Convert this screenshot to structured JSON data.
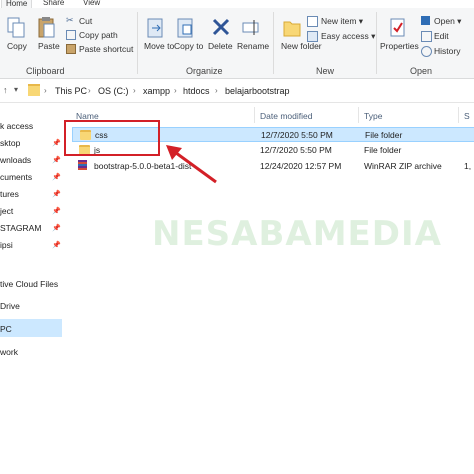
{
  "tabs": [
    "Home",
    "Share",
    "View"
  ],
  "ribbon": {
    "clipboard": {
      "copy": "Copy",
      "paste": "Paste",
      "cut": "Cut",
      "copy_path": "Copy path",
      "paste_shortcut": "Paste shortcut",
      "label": "Clipboard"
    },
    "organize": {
      "move_to": "Move to",
      "copy_to": "Copy to",
      "delete": "Delete",
      "rename": "Rename",
      "label": "Organize"
    },
    "new": {
      "new_folder": "New folder",
      "new_item": "New item",
      "easy_access": "Easy access",
      "label": "New"
    },
    "open": {
      "properties": "Properties",
      "open": "Open",
      "edit": "Edit",
      "history": "History",
      "label": "Open"
    }
  },
  "address": {
    "crumbs": [
      "This PC",
      "OS (C:)",
      "xampp",
      "htdocs",
      "belajarbootstrap"
    ]
  },
  "nav": {
    "items": [
      "k access",
      "sktop",
      "wnloads",
      "cuments",
      "tures",
      "ject",
      "STAGRAM",
      "ipsi",
      "tive Cloud Files",
      "Drive",
      "PC",
      "work"
    ]
  },
  "columns": {
    "name": "Name",
    "date": "Date modified",
    "type": "Type",
    "size": "S"
  },
  "files": [
    {
      "name": "css",
      "date": "12/7/2020 5:50 PM",
      "type": "File folder",
      "size": ""
    },
    {
      "name": "js",
      "date": "12/7/2020 5:50 PM",
      "type": "File folder",
      "size": ""
    },
    {
      "name": "bootstrap-5.0.0-beta1-dist",
      "date": "12/24/2020 12:57 PM",
      "type": "WinRAR ZIP archive",
      "size": "1,"
    }
  ],
  "watermark": "NESABAMEDIA",
  "colors": {
    "highlight": "#d32027",
    "folder": "#f8d775",
    "selected": "#cce8ff"
  }
}
